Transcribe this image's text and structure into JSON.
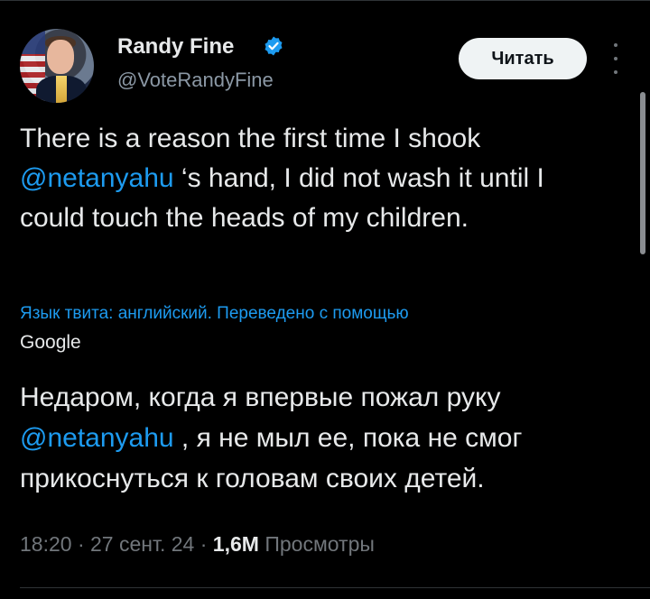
{
  "author": {
    "name": "Randy Fine",
    "handle": "@VoteRandyFine"
  },
  "actions": {
    "read_label": "Читать"
  },
  "tweet": {
    "text_before_mention": "There is a reason the first time I shook ",
    "mention": "@netanyahu",
    "text_after_mention": " ‘s hand, I did not wash it until I could touch the heads of my children."
  },
  "translation_note": {
    "text": "Язык твита: английский. Переведено с помощью",
    "provider": "Google"
  },
  "translation": {
    "line1": "Недаром, когда я впервые пожал руку ",
    "mention": "@netanyahu",
    "rest": " , я не мыл ее, пока не смог прикоснуться к головам своих детей."
  },
  "meta": {
    "time": "18:20",
    "sep1": " · ",
    "date": "27 сент. 24",
    "sep2": " · ",
    "views_count": "1,6M",
    "views_label": " Просмотры"
  },
  "colors": {
    "accent": "#1d9bf0",
    "background": "#000000",
    "text": "#e7e9ea",
    "secondary": "#71767b"
  },
  "icons": [
    "verified-badge-icon",
    "more-options-icon"
  ]
}
